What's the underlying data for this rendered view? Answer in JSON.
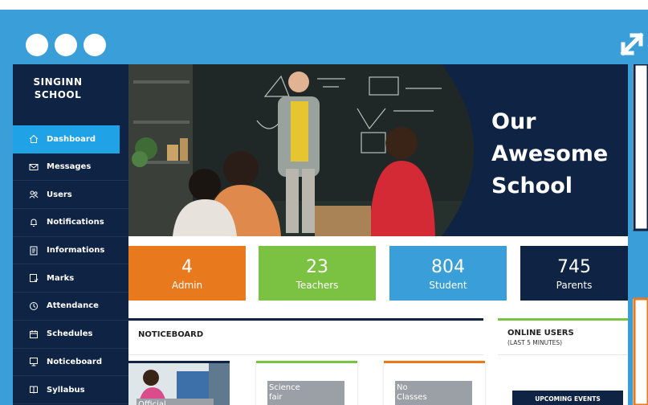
{
  "window": {
    "controls": [
      "dot-1",
      "dot-2",
      "dot-3"
    ],
    "expand_icon": "expand-icon"
  },
  "sidebar": {
    "brand_line1": "SINGINN",
    "brand_line2": "SCHOOL",
    "items": [
      {
        "label": "Dashboard",
        "icon": "home-icon",
        "active": true
      },
      {
        "label": "Messages",
        "icon": "envelope-icon"
      },
      {
        "label": "Users",
        "icon": "users-icon"
      },
      {
        "label": "Notifications",
        "icon": "bell-icon"
      },
      {
        "label": "Informations",
        "icon": "info-icon"
      },
      {
        "label": "Marks",
        "icon": "marks-icon"
      },
      {
        "label": "Attendance",
        "icon": "attendance-icon"
      },
      {
        "label": "Schedules",
        "icon": "calendar-icon"
      },
      {
        "label": "Noticeboard",
        "icon": "noticeboard-icon"
      },
      {
        "label": "Syllabus",
        "icon": "syllabus-icon"
      }
    ]
  },
  "hero": {
    "line1": "Our",
    "line2": "Awesome",
    "line3": "School"
  },
  "stats": [
    {
      "value": "4",
      "label": "Admin",
      "color": "#e8791d"
    },
    {
      "value": "23",
      "label": "Teachers",
      "color": "#7cc242"
    },
    {
      "value": "804",
      "label": "Student",
      "color": "#3a9fd9"
    },
    {
      "value": "745",
      "label": "Parents",
      "color": "#0f2344"
    }
  ],
  "noticeboard": {
    "title": "NOTICEBOARD",
    "cards": [
      {
        "tag": "Official"
      },
      {
        "tag_line1": "Science",
        "tag_line2": "fair",
        "accent": "#7cc242"
      },
      {
        "tag_line1": "No",
        "tag_line2": "Classes",
        "accent": "#e8791d"
      }
    ]
  },
  "online": {
    "title": "ONLINE USERS",
    "subtitle": "(LAST 5 MINUTES)",
    "upcoming": "UPCOMING EVENTS"
  },
  "colors": {
    "frame": "#3a9fd9",
    "navy": "#0f2344",
    "active": "#1fa3e6"
  }
}
